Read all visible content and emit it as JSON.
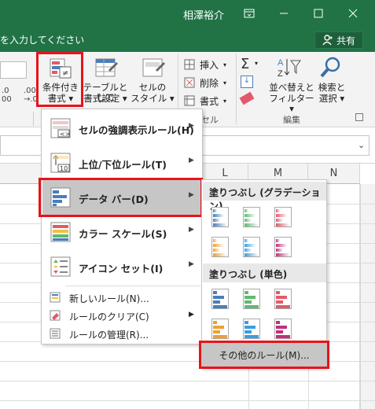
{
  "titlebar": {
    "user": "相澤裕介",
    "tell_me": "を入力してください",
    "share": "共有"
  },
  "ribbon": {
    "cond_format": [
      "条件付き",
      "書式 ▾"
    ],
    "table": [
      "テーブルとして",
      "書式設定 ▾"
    ],
    "cell_style": [
      "セルの",
      "スタイル ▾"
    ],
    "insert": "挿入",
    "delete": "削除",
    "format": "書式",
    "group_cells": "セル",
    "sort": [
      "並べ替えと",
      "フィルター ▾"
    ],
    "find": [
      "検索と",
      "選択 ▾"
    ],
    "group_edit": "編集"
  },
  "columns": [
    "L",
    "M",
    "N"
  ],
  "menu": {
    "items": [
      {
        "label": "セルの強調表示ルール(H)"
      },
      {
        "label": "上位/下位ルール(T)"
      },
      {
        "label": "データ バー(D)"
      },
      {
        "label": "カラー スケール(S)"
      },
      {
        "label": "アイコン セット(I)"
      }
    ],
    "small": [
      {
        "label": "新しいルール(N)..."
      },
      {
        "label": "ルールのクリア(C)"
      },
      {
        "label": "ルールの管理(R)..."
      }
    ]
  },
  "submenu": {
    "gradient": "塗りつぶし (グラデーション)",
    "solid": "塗りつぶし (単色)",
    "more": "その他のルール(M)..."
  },
  "bar_colors": [
    "#4a7ebb",
    "#5fb96f",
    "#e25a6a",
    "#f0a030",
    "#3a9de0",
    "#c0307a"
  ],
  "highlight_color": "#e8131a"
}
